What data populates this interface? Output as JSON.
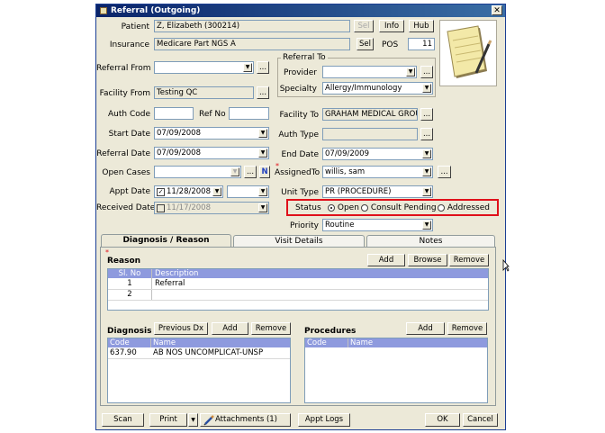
{
  "window": {
    "title": "Referral (Outgoing)",
    "close_glyph": "✕"
  },
  "fields": {
    "patient_label": "Patient",
    "patient_value": "Z, Elizabeth   (300214)",
    "insurance_label": "Insurance",
    "insurance_value": "Medicare Part NGS A",
    "pos_label": "POS",
    "pos_value": "11",
    "referral_from_label": "Referral From",
    "referral_from_value": "",
    "facility_from_label": "Facility From",
    "facility_from_value": "Testing QC",
    "auth_code_label": "Auth Code",
    "auth_code_value": "",
    "ref_no_label": "Ref No",
    "ref_no_value": "",
    "start_date_label": "Start Date",
    "start_date_value": "07/09/2008",
    "referral_date_label": "Referral Date",
    "referral_date_value": "07/09/2008",
    "open_cases_label": "Open Cases",
    "open_cases_value": "",
    "appt_date_label": "Appt Date",
    "appt_date_value": "11/28/2008",
    "appt_time_value": "",
    "received_date_label": "Received Date",
    "received_date_value": "11/17/2008",
    "referral_to_group": "Referral To",
    "provider_label": "Provider",
    "provider_value": "",
    "specialty_label": "Specialty",
    "specialty_value": "Allergy/Immunology",
    "facility_to_label": "Facility To",
    "facility_to_value": "GRAHAM MEDICAL GROU",
    "auth_type_label": "Auth Type",
    "auth_type_value": "",
    "end_date_label": "End Date",
    "end_date_value": "07/09/2009",
    "assigned_to_label": "AssignedTo",
    "assigned_to_value": "willis, sam",
    "unit_type_label": "Unit Type",
    "unit_type_value": "PR (PROCEDURE)",
    "status_label": "Status",
    "status_options": [
      "Open",
      "Consult Pending",
      "Addressed"
    ],
    "status_selected": "Open",
    "priority_label": "Priority",
    "priority_value": "Routine"
  },
  "buttons": {
    "sel": "Sel",
    "info": "Info",
    "hub": "Hub",
    "ellipsis": "...",
    "n": "N",
    "add": "Add",
    "browse": "Browse",
    "remove": "Remove",
    "previous_dx": "Previous Dx",
    "scan": "Scan",
    "print": "Print",
    "attachments": "Attachments (1)",
    "appt_logs": "Appt Logs",
    "ok": "OK",
    "cancel": "Cancel"
  },
  "tabs": [
    "Diagnosis / Reason",
    "Visit Details",
    "Notes"
  ],
  "reason": {
    "title": "Reason",
    "columns": [
      "Sl. No",
      "Description"
    ],
    "rows": [
      {
        "no": "1",
        "desc": "Referral"
      },
      {
        "no": "2",
        "desc": ""
      }
    ]
  },
  "diagnosis": {
    "title": "Diagnosis",
    "columns": [
      "Code",
      "Name"
    ],
    "rows": [
      {
        "code": "637.90",
        "name": "AB NOS UNCOMPLICAT-UNSP"
      }
    ]
  },
  "procedures": {
    "title": "Procedures",
    "columns": [
      "Code",
      "Name"
    ]
  },
  "icons": {
    "notepad": "notepad-icon",
    "attachments": "pencil-icon",
    "checkbox_mark": "✓",
    "dropdown": "▼"
  }
}
